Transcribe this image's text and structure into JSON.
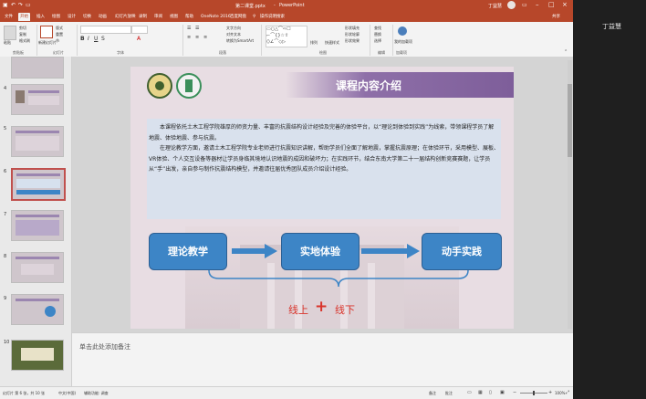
{
  "titlebar": {
    "doc_title": "第二课堂.pptx",
    "app_name": "PowerPoint",
    "user_name": "丁益慧",
    "share_label": "共享"
  },
  "tabs": [
    "文件",
    "开始",
    "插入",
    "绘图",
    "设计",
    "切换",
    "动画",
    "幻灯片放映",
    "录制",
    "审阅",
    "视图",
    "帮助",
    "OneNote 2016",
    "百度网盘",
    "操作说明搜索"
  ],
  "active_tab": "开始",
  "ribbon": {
    "groups": [
      "剪贴板",
      "幻灯片",
      "字体",
      "段落",
      "绘图",
      "编辑",
      "加载项"
    ],
    "paste": "粘贴",
    "cut": "剪切",
    "copy": "复制",
    "format_painter": "格式刷",
    "new_slide": "新建幻灯片",
    "layout": "版式",
    "reset": "重置",
    "section": "节",
    "text_direction": "文字方向",
    "align_text": "对齐文本",
    "smartart": "转换为SmartArt",
    "arrange": "排列",
    "quick_styles": "快速样式",
    "shape_fill": "形状填充",
    "shape_outline": "形状轮廓",
    "shape_effects": "形状效果",
    "find": "查找",
    "replace": "替换",
    "select": "选择",
    "addin": "我的加载项"
  },
  "thumbnails": [
    {
      "num": "4"
    },
    {
      "num": "5"
    },
    {
      "num": "6"
    },
    {
      "num": "7"
    },
    {
      "num": "8"
    },
    {
      "num": "9"
    },
    {
      "num": "10"
    }
  ],
  "slide": {
    "heading": "课程内容介绍",
    "paragraphs": [
      "本课程依托土木工程学院雄厚的师资力量、丰富的抗震结构设计经验及完善的体验平台，以“理论到体验到实践”为线索，带领课程学员了解地震、体验地震、参与抗震。",
      "在理论教学方面，邀请土木工程学院专业老师进行抗震知识讲解，帮助学员们全面了解地震，掌握抗震原理；在体验环节，采用模型、展板、VR体验、个人交互设备等器材让学员身临其境地认识地震的成因和破坏力；在实践环节，结合东南大学第二十一届结构创新竞赛赛题，让学员从“手”出发，亲自参与制作抗震结构模型，并邀请往届优秀团队成员介绍设计经验。"
    ],
    "flow": [
      "理论教学",
      "实地体验",
      "动手实践"
    ],
    "bottom_left": "线上",
    "plus": "+",
    "bottom_right": "线下"
  },
  "notes_placeholder": "单击此处添加备注",
  "status": {
    "slide_info": "幻灯片 第 6 张，共 10 张",
    "language": "中文(中国)",
    "accessibility": "辅助功能: 调查",
    "notes_btn": "备注",
    "comments_btn": "批注",
    "zoom": "100%"
  },
  "colors": {
    "accent": "#b7472a",
    "flow_box": "#3d85c6",
    "heading_band": "#8e6fa8",
    "plus_red": "#d9342b"
  }
}
